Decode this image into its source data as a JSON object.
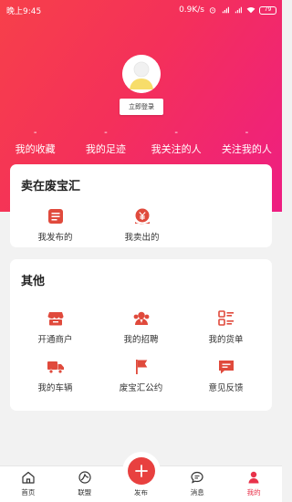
{
  "status_bar": {
    "time": "晚上9:45",
    "network_speed": "0.9K/s",
    "battery": "79"
  },
  "profile": {
    "login_label": "立即登录"
  },
  "stats": [
    {
      "value": "-",
      "label": "我的收藏"
    },
    {
      "value": "-",
      "label": "我的足迹"
    },
    {
      "value": "-",
      "label": "我关注的人"
    },
    {
      "value": "-",
      "label": "关注我的人"
    }
  ],
  "seller_section": {
    "title": "卖在废宝汇",
    "items": [
      {
        "label": "我发布的",
        "icon": "published-list-icon"
      },
      {
        "label": "我卖出的",
        "icon": "sold-yen-icon"
      }
    ]
  },
  "other_section": {
    "title": "其他",
    "items": [
      {
        "label": "开通商户",
        "icon": "store-icon"
      },
      {
        "label": "我的招聘",
        "icon": "recruit-icon"
      },
      {
        "label": "我的货单",
        "icon": "order-list-icon"
      },
      {
        "label": "我的车辆",
        "icon": "truck-icon"
      },
      {
        "label": "废宝汇公约",
        "icon": "flag-icon"
      },
      {
        "label": "意见反馈",
        "icon": "feedback-icon"
      }
    ]
  },
  "tabbar": {
    "tabs": [
      {
        "label": "首页",
        "icon": "home-icon"
      },
      {
        "label": "联盟",
        "icon": "alliance-icon"
      },
      {
        "label": "发布",
        "icon": "plus-icon"
      },
      {
        "label": "消息",
        "icon": "message-icon"
      },
      {
        "label": "我的",
        "icon": "person-icon"
      }
    ],
    "active": "我的"
  },
  "colors": {
    "accent": "#e8324a",
    "gradient_start": "#f7404a",
    "gradient_end": "#ee1e82",
    "icon_red": "#e04a3c"
  }
}
